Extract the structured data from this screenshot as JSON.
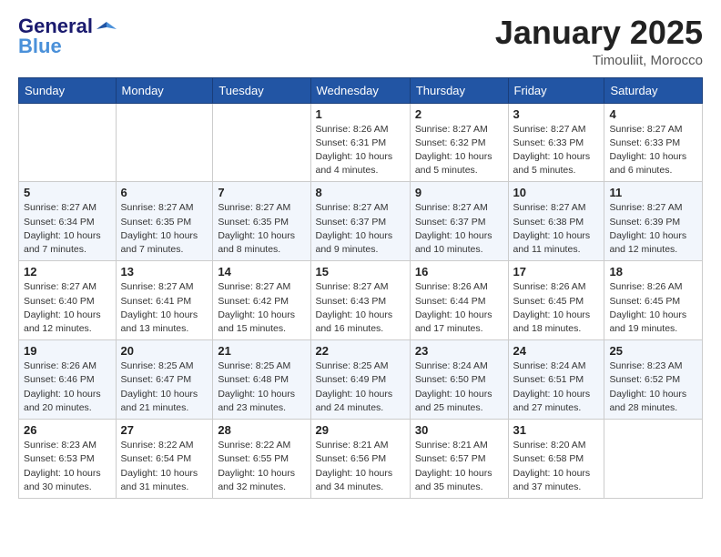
{
  "header": {
    "logo_general": "General",
    "logo_blue": "Blue",
    "month_title": "January 2025",
    "location": "Timouliit, Morocco"
  },
  "weekdays": [
    "Sunday",
    "Monday",
    "Tuesday",
    "Wednesday",
    "Thursday",
    "Friday",
    "Saturday"
  ],
  "weeks": [
    [
      {
        "day": "",
        "info": ""
      },
      {
        "day": "",
        "info": ""
      },
      {
        "day": "",
        "info": ""
      },
      {
        "day": "1",
        "info": "Sunrise: 8:26 AM\nSunset: 6:31 PM\nDaylight: 10 hours\nand 4 minutes."
      },
      {
        "day": "2",
        "info": "Sunrise: 8:27 AM\nSunset: 6:32 PM\nDaylight: 10 hours\nand 5 minutes."
      },
      {
        "day": "3",
        "info": "Sunrise: 8:27 AM\nSunset: 6:33 PM\nDaylight: 10 hours\nand 5 minutes."
      },
      {
        "day": "4",
        "info": "Sunrise: 8:27 AM\nSunset: 6:33 PM\nDaylight: 10 hours\nand 6 minutes."
      }
    ],
    [
      {
        "day": "5",
        "info": "Sunrise: 8:27 AM\nSunset: 6:34 PM\nDaylight: 10 hours\nand 7 minutes."
      },
      {
        "day": "6",
        "info": "Sunrise: 8:27 AM\nSunset: 6:35 PM\nDaylight: 10 hours\nand 7 minutes."
      },
      {
        "day": "7",
        "info": "Sunrise: 8:27 AM\nSunset: 6:35 PM\nDaylight: 10 hours\nand 8 minutes."
      },
      {
        "day": "8",
        "info": "Sunrise: 8:27 AM\nSunset: 6:37 PM\nDaylight: 10 hours\nand 9 minutes."
      },
      {
        "day": "9",
        "info": "Sunrise: 8:27 AM\nSunset: 6:37 PM\nDaylight: 10 hours\nand 10 minutes."
      },
      {
        "day": "10",
        "info": "Sunrise: 8:27 AM\nSunset: 6:38 PM\nDaylight: 10 hours\nand 11 minutes."
      },
      {
        "day": "11",
        "info": "Sunrise: 8:27 AM\nSunset: 6:39 PM\nDaylight: 10 hours\nand 12 minutes."
      }
    ],
    [
      {
        "day": "12",
        "info": "Sunrise: 8:27 AM\nSunset: 6:40 PM\nDaylight: 10 hours\nand 12 minutes."
      },
      {
        "day": "13",
        "info": "Sunrise: 8:27 AM\nSunset: 6:41 PM\nDaylight: 10 hours\nand 13 minutes."
      },
      {
        "day": "14",
        "info": "Sunrise: 8:27 AM\nSunset: 6:42 PM\nDaylight: 10 hours\nand 15 minutes."
      },
      {
        "day": "15",
        "info": "Sunrise: 8:27 AM\nSunset: 6:43 PM\nDaylight: 10 hours\nand 16 minutes."
      },
      {
        "day": "16",
        "info": "Sunrise: 8:26 AM\nSunset: 6:44 PM\nDaylight: 10 hours\nand 17 minutes."
      },
      {
        "day": "17",
        "info": "Sunrise: 8:26 AM\nSunset: 6:45 PM\nDaylight: 10 hours\nand 18 minutes."
      },
      {
        "day": "18",
        "info": "Sunrise: 8:26 AM\nSunset: 6:45 PM\nDaylight: 10 hours\nand 19 minutes."
      }
    ],
    [
      {
        "day": "19",
        "info": "Sunrise: 8:26 AM\nSunset: 6:46 PM\nDaylight: 10 hours\nand 20 minutes."
      },
      {
        "day": "20",
        "info": "Sunrise: 8:25 AM\nSunset: 6:47 PM\nDaylight: 10 hours\nand 21 minutes."
      },
      {
        "day": "21",
        "info": "Sunrise: 8:25 AM\nSunset: 6:48 PM\nDaylight: 10 hours\nand 23 minutes."
      },
      {
        "day": "22",
        "info": "Sunrise: 8:25 AM\nSunset: 6:49 PM\nDaylight: 10 hours\nand 24 minutes."
      },
      {
        "day": "23",
        "info": "Sunrise: 8:24 AM\nSunset: 6:50 PM\nDaylight: 10 hours\nand 25 minutes."
      },
      {
        "day": "24",
        "info": "Sunrise: 8:24 AM\nSunset: 6:51 PM\nDaylight: 10 hours\nand 27 minutes."
      },
      {
        "day": "25",
        "info": "Sunrise: 8:23 AM\nSunset: 6:52 PM\nDaylight: 10 hours\nand 28 minutes."
      }
    ],
    [
      {
        "day": "26",
        "info": "Sunrise: 8:23 AM\nSunset: 6:53 PM\nDaylight: 10 hours\nand 30 minutes."
      },
      {
        "day": "27",
        "info": "Sunrise: 8:22 AM\nSunset: 6:54 PM\nDaylight: 10 hours\nand 31 minutes."
      },
      {
        "day": "28",
        "info": "Sunrise: 8:22 AM\nSunset: 6:55 PM\nDaylight: 10 hours\nand 32 minutes."
      },
      {
        "day": "29",
        "info": "Sunrise: 8:21 AM\nSunset: 6:56 PM\nDaylight: 10 hours\nand 34 minutes."
      },
      {
        "day": "30",
        "info": "Sunrise: 8:21 AM\nSunset: 6:57 PM\nDaylight: 10 hours\nand 35 minutes."
      },
      {
        "day": "31",
        "info": "Sunrise: 8:20 AM\nSunset: 6:58 PM\nDaylight: 10 hours\nand 37 minutes."
      },
      {
        "day": "",
        "info": ""
      }
    ]
  ]
}
